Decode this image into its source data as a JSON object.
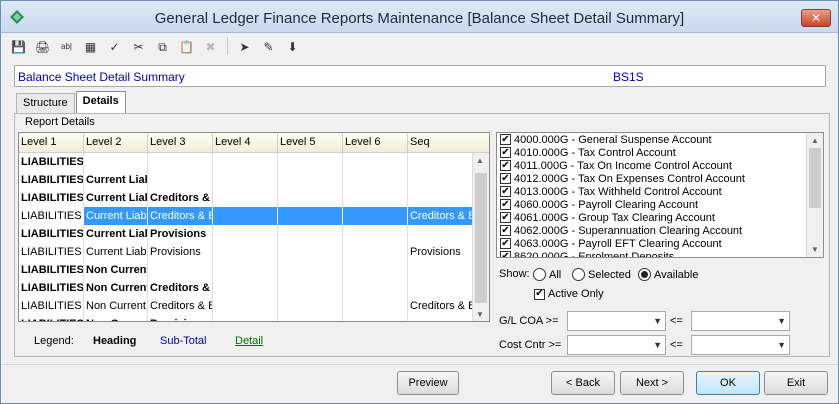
{
  "window": {
    "title": "General Ledger Finance Reports Maintenance  [Balance Sheet Detail Summary]",
    "close_label": "✕"
  },
  "toolbar": [
    {
      "name": "save-icon",
      "glyph": "💾",
      "disabled": true
    },
    {
      "name": "print-icon",
      "glyph": "🖨",
      "disabled": false
    },
    {
      "name": "text-field-icon",
      "glyph": "ab|",
      "disabled": false
    },
    {
      "name": "calculator-icon",
      "glyph": "▦",
      "disabled": false
    },
    {
      "name": "spellcheck-icon",
      "glyph": "✓",
      "disabled": false
    },
    {
      "name": "cut-icon",
      "glyph": "✂",
      "disabled": false
    },
    {
      "name": "copy-icon",
      "glyph": "⧉",
      "disabled": false
    },
    {
      "name": "paste-icon",
      "glyph": "📋",
      "disabled": false
    },
    {
      "name": "delete-icon",
      "glyph": "✖",
      "disabled": true
    },
    {
      "name": "navigate-icon",
      "glyph": "➤",
      "disabled": false
    },
    {
      "name": "approve-icon",
      "glyph": "✎",
      "disabled": false
    },
    {
      "name": "download-icon",
      "glyph": "⬇",
      "disabled": false
    }
  ],
  "header": {
    "title": "Balance Sheet Detail Summary",
    "code": "BS1S"
  },
  "tabs": [
    {
      "label": "Structure",
      "active": false
    },
    {
      "label": "Details",
      "active": true
    }
  ],
  "report_details": {
    "group_label": "Report Details",
    "columns": [
      "Level 1",
      "Level 2",
      "Level 3",
      "Level 4",
      "Level 5",
      "Level 6",
      "Seq"
    ],
    "rows": [
      {
        "type": "heading",
        "cells": [
          "LIABILITIES",
          "",
          "",
          "",
          "",
          "",
          ""
        ]
      },
      {
        "type": "heading",
        "cells": [
          "LIABILITIES",
          "Current Liabilities",
          "",
          "",
          "",
          "",
          ""
        ]
      },
      {
        "type": "heading",
        "cells": [
          "LIABILITIES",
          "Current Liabilities",
          "Creditors & Borrowings",
          "",
          "",
          "",
          ""
        ]
      },
      {
        "type": "selected",
        "cells": [
          "LIABILITIES",
          "Current Liabilities",
          "Creditors & Borrowings",
          "",
          "",
          "",
          "Creditors & Borrowings"
        ]
      },
      {
        "type": "heading",
        "cells": [
          "LIABILITIES",
          "Current Liabilities",
          "Provisions",
          "",
          "",
          "",
          ""
        ]
      },
      {
        "type": "normal",
        "cells": [
          "LIABILITIES",
          "Current Liabilities",
          "Provisions",
          "",
          "",
          "",
          "Provisions"
        ]
      },
      {
        "type": "heading",
        "cells": [
          "LIABILITIES",
          "Non Current",
          "",
          "",
          "",
          "",
          ""
        ]
      },
      {
        "type": "heading",
        "cells": [
          "LIABILITIES",
          "Non Current",
          "Creditors & Borrowings",
          "",
          "",
          "",
          ""
        ]
      },
      {
        "type": "normal",
        "cells": [
          "LIABILITIES",
          "Non Current",
          "Creditors & Borrowings",
          "",
          "",
          "",
          "Creditors & Borrowings"
        ]
      },
      {
        "type": "heading",
        "cells": [
          "LIABILITIES",
          "Non Current",
          "Provisions",
          "",
          "",
          "",
          ""
        ]
      }
    ]
  },
  "legend": {
    "label": "Legend:",
    "heading": "Heading",
    "subtotal": "Sub-Total",
    "detail": "Detail"
  },
  "accounts": [
    {
      "label": "4000.000G - General Suspense Account",
      "checked": true
    },
    {
      "label": "4010.000G - Tax Control Account",
      "checked": true
    },
    {
      "label": "4011.000G - Tax On Income Control Account",
      "checked": true
    },
    {
      "label": "4012.000G - Tax On Expenses Control Account",
      "checked": true
    },
    {
      "label": "4013.000G - Tax Withheld Control Account",
      "checked": true
    },
    {
      "label": "4060.000G - Payroll Clearing Account",
      "checked": true
    },
    {
      "label": "4061.000G - Group Tax Clearing Account",
      "checked": true
    },
    {
      "label": "4062.000G - Superannuation Clearing Account",
      "checked": true
    },
    {
      "label": "4063.000G - Payroll EFT Clearing Account",
      "checked": true
    },
    {
      "label": "8620.000G - Enrolment Deposits",
      "checked": true
    }
  ],
  "show": {
    "label": "Show:",
    "options": [
      "All",
      "Selected",
      "Available"
    ],
    "selected": "Available"
  },
  "active_only": {
    "label": "Active Only",
    "checked": true
  },
  "filters": {
    "gl_label": "G/L COA >=",
    "cost_label": "Cost Cntr >=",
    "le_label": "<=",
    "gl_from": "",
    "gl_to": "",
    "cost_from": "",
    "cost_to": ""
  },
  "buttons": {
    "preview": "Preview",
    "back": "< Back",
    "next": "Next >",
    "ok": "OK",
    "exit": "Exit"
  },
  "colors": {
    "accent_blue": "#0000c8",
    "selection": "#3399ff",
    "detail_green": "#007000"
  }
}
